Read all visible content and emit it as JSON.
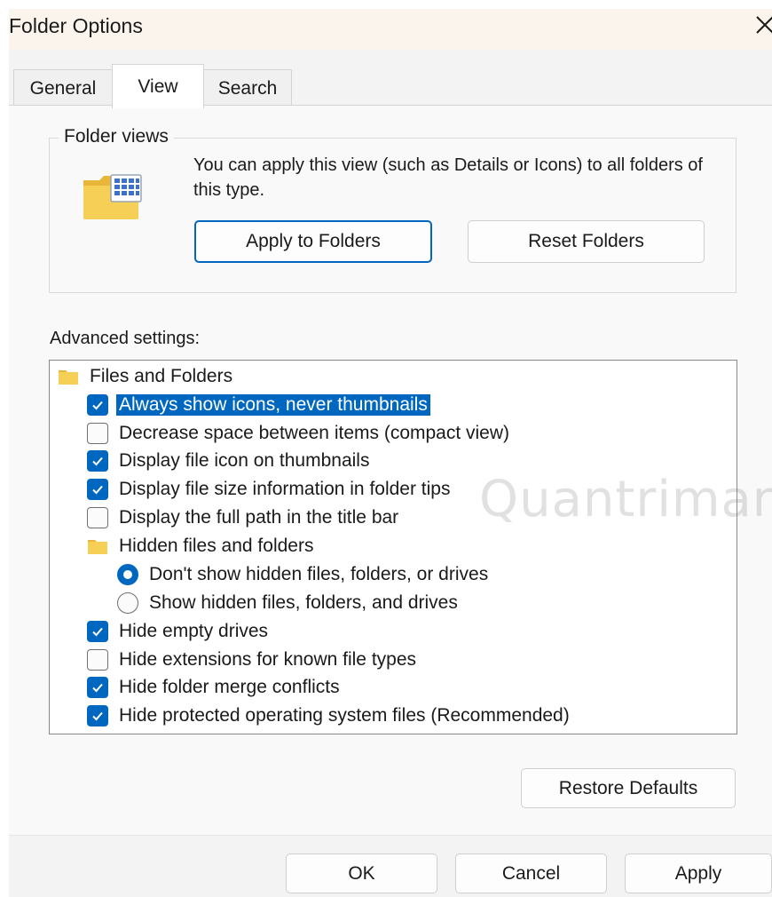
{
  "window": {
    "title": "Folder Options",
    "close_icon": "close-icon"
  },
  "tabs": [
    {
      "label": "General",
      "active": false
    },
    {
      "label": "View",
      "active": true
    },
    {
      "label": "Search",
      "active": false
    }
  ],
  "folder_views": {
    "legend": "Folder views",
    "description": "You can apply this view (such as Details or Icons) to all folders of this type.",
    "apply_button": "Apply to Folders",
    "reset_button": "Reset Folders",
    "icon": "folder-view-icon"
  },
  "advanced": {
    "label": "Advanced settings:",
    "items": [
      {
        "type": "folder",
        "label": "Files and Folders"
      },
      {
        "type": "checkbox",
        "label": "Always show icons, never thumbnails",
        "checked": true,
        "selected": true
      },
      {
        "type": "checkbox",
        "label": "Decrease space between items (compact view)",
        "checked": false
      },
      {
        "type": "checkbox",
        "label": "Display file icon on thumbnails",
        "checked": true
      },
      {
        "type": "checkbox",
        "label": "Display file size information in folder tips",
        "checked": true
      },
      {
        "type": "checkbox",
        "label": "Display the full path in the title bar",
        "checked": false
      },
      {
        "type": "folder",
        "label": "Hidden files and folders"
      },
      {
        "type": "radio",
        "label": "Don't show hidden files, folders, or drives",
        "checked": true
      },
      {
        "type": "radio",
        "label": "Show hidden files, folders, and drives",
        "checked": false
      },
      {
        "type": "checkbox",
        "label": "Hide empty drives",
        "checked": true
      },
      {
        "type": "checkbox",
        "label": "Hide extensions for known file types",
        "checked": false
      },
      {
        "type": "checkbox",
        "label": "Hide folder merge conflicts",
        "checked": true
      },
      {
        "type": "checkbox",
        "label": "Hide protected operating system files (Recommended)",
        "checked": true
      }
    ]
  },
  "restore_defaults": "Restore Defaults",
  "footer": {
    "ok": "OK",
    "cancel": "Cancel",
    "apply": "Apply"
  },
  "watermark": "Quantrimang",
  "colors": {
    "accent": "#0067c0",
    "titlebar": "#fbf4ec",
    "panel": "#f9f9f9"
  }
}
